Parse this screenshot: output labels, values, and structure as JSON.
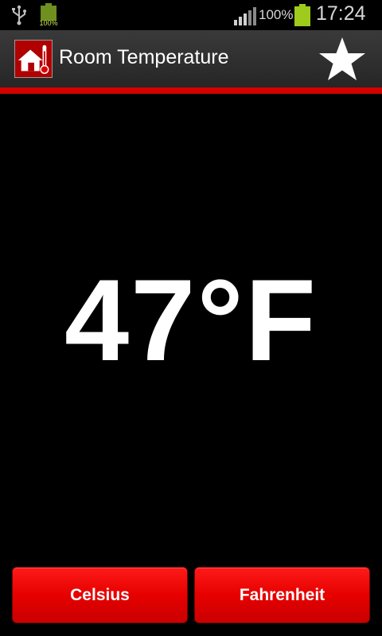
{
  "status_bar": {
    "battery_small_label": "100%",
    "battery_percent": "100%",
    "time": "17:24",
    "icons": [
      "usb-icon",
      "battery-small-icon",
      "signal-icon",
      "battery-icon"
    ]
  },
  "action_bar": {
    "title": "Room Temperature",
    "app_icon": "house-thermometer-icon",
    "star_icon": "star-icon"
  },
  "main": {
    "temperature": "47°F"
  },
  "buttons": {
    "celsius_label": "Celsius",
    "fahrenheit_label": "Fahrenheit"
  },
  "colors": {
    "accent_red": "#d40000",
    "button_red": "#e60000",
    "battery_green": "#9ecb1c",
    "background": "#000000"
  }
}
